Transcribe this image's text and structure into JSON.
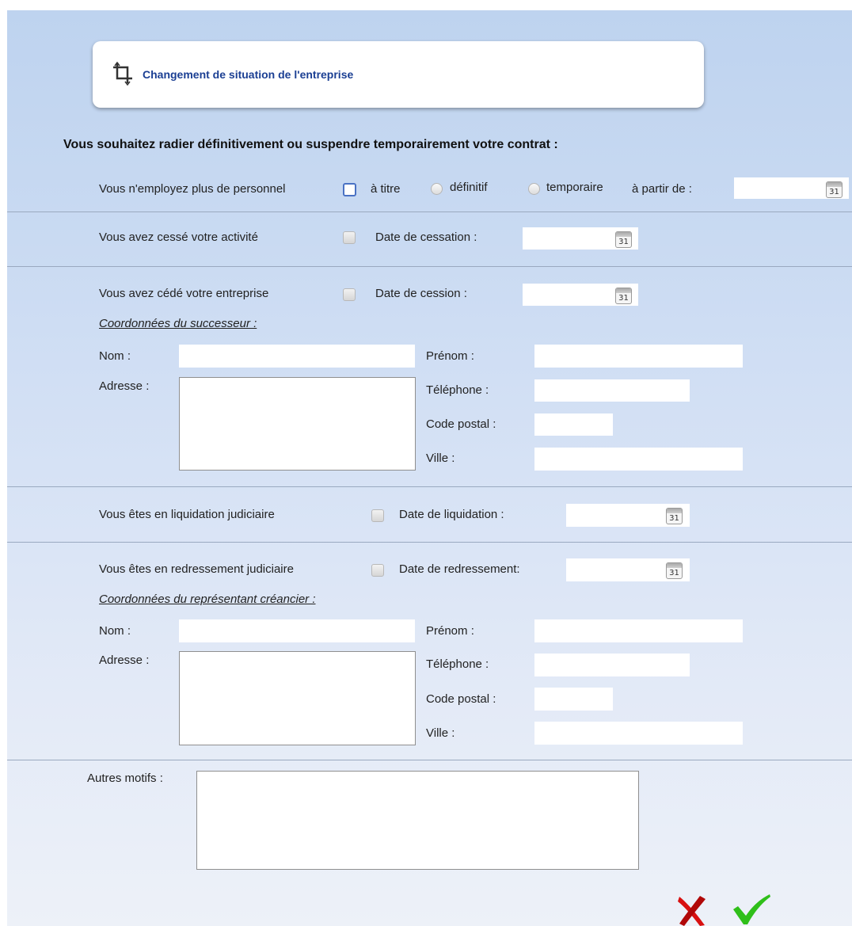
{
  "header": {
    "title": "Changement de situation de l'entreprise",
    "icon": "crop-icon"
  },
  "question": "Vous souhaitez radier définitivement ou suspendre temporairement votre contrat :",
  "calendar_day": "31",
  "row1": {
    "label": "Vous n'employez plus de personnel",
    "a_titre": "à titre",
    "definitif": "définitif",
    "temporaire": "temporaire",
    "a_partir_de": "à partir de :"
  },
  "row2": {
    "label": "Vous avez cessé votre activité",
    "date_label": "Date de cessation :"
  },
  "row3": {
    "label": "Vous avez cédé votre entreprise",
    "date_label": "Date de cession :",
    "coords_title": "Coordonnées du successeur :",
    "nom": "Nom :",
    "adresse": "Adresse :",
    "prenom": "Prénom :",
    "telephone": "Téléphone :",
    "code_postal": "Code postal :",
    "ville": "Ville :"
  },
  "row4": {
    "label": "Vous êtes en liquidation judiciaire",
    "date_label": "Date de liquidation :"
  },
  "row5": {
    "label": "Vous êtes en redressement judiciaire",
    "date_label": "Date de redressement:",
    "coords_title": "Coordonnées du représentant créancier :",
    "nom": "Nom :",
    "adresse": "Adresse :",
    "prenom": "Prénom :",
    "telephone": "Téléphone :",
    "code_postal": "Code postal :",
    "ville": "Ville :"
  },
  "autres": {
    "label": "Autres motifs :"
  },
  "actions": {
    "cancel_icon": "red-x-icon",
    "confirm_icon": "green-check-icon"
  },
  "colors": {
    "title_blue": "#1b3f93",
    "cancel_red": "#d81010",
    "confirm_green": "#2fbf1a"
  }
}
